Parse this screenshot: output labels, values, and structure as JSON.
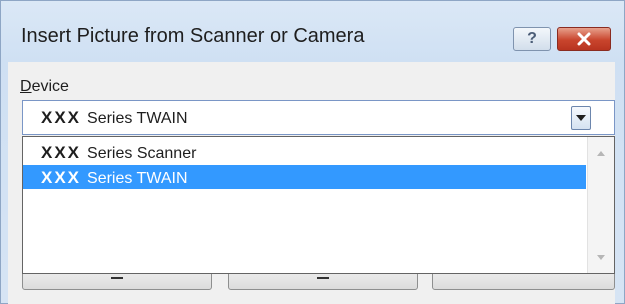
{
  "window": {
    "title": "Insert Picture from Scanner or Camera",
    "help_label": "?"
  },
  "device": {
    "label_underlined": "D",
    "label_rest": "evice",
    "selected_brand": "XXX",
    "selected_name": "Series TWAIN"
  },
  "dropdown": {
    "items": [
      {
        "brand": "XXX",
        "name": "Series Scanner",
        "selected": false
      },
      {
        "brand": "XXX",
        "name": "Series TWAIN",
        "selected": true
      }
    ]
  },
  "colors": {
    "selection": "#3399ff",
    "close_button": "#c9452d"
  },
  "icons": {
    "help": "question-mark-icon",
    "close": "close-icon",
    "combo_arrow": "chevron-down-icon",
    "scroll_up": "scroll-up-arrow-icon",
    "scroll_down": "scroll-down-arrow-icon"
  }
}
